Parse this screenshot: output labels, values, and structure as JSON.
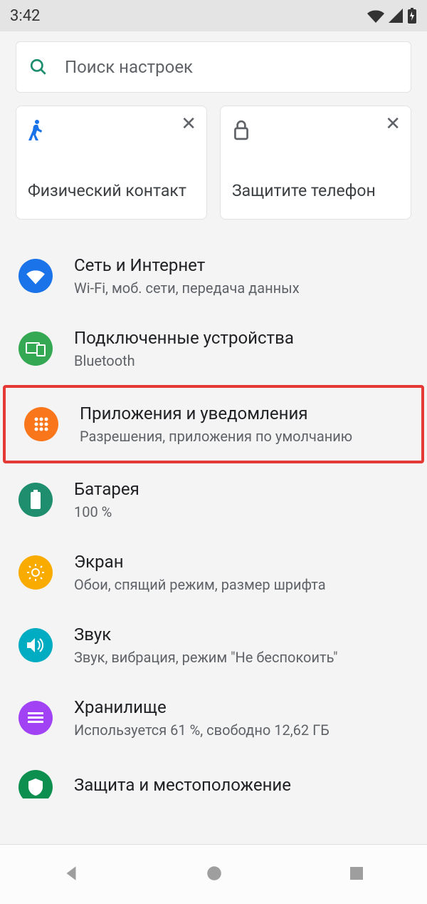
{
  "status": {
    "time": "3:42"
  },
  "search": {
    "placeholder": "Поиск настроек"
  },
  "cards": [
    {
      "title": "Физический контакт"
    },
    {
      "title": "Защитите телефон"
    }
  ],
  "colors": {
    "network": "#1a73e8",
    "devices": "#34a853",
    "apps": "#f9761b",
    "battery": "#1e8e6e",
    "display": "#f9ab00",
    "sound": "#00acc1",
    "storage": "#a142f4",
    "security": "#0d904f",
    "highlight": "#e53935"
  },
  "items": [
    {
      "key": "network",
      "title": "Сеть и Интернет",
      "subtitle": "Wi-Fi, моб. сети, передача данных"
    },
    {
      "key": "devices",
      "title": "Подключенные устройства",
      "subtitle": "Bluetooth"
    },
    {
      "key": "apps",
      "title": "Приложения и уведомления",
      "subtitle": "Разрешения, приложения по умолчанию"
    },
    {
      "key": "battery",
      "title": "Батарея",
      "subtitle": "100 %"
    },
    {
      "key": "display",
      "title": "Экран",
      "subtitle": "Обои, спящий режим, размер шрифта"
    },
    {
      "key": "sound",
      "title": "Звук",
      "subtitle": "Звук, вибрация, режим \"Не беспокоить\""
    },
    {
      "key": "storage",
      "title": "Хранилище",
      "subtitle": "Используется 61 %, свободно 12,62 ГБ"
    },
    {
      "key": "security",
      "title": "Защита и местоположение",
      "subtitle": ""
    }
  ]
}
